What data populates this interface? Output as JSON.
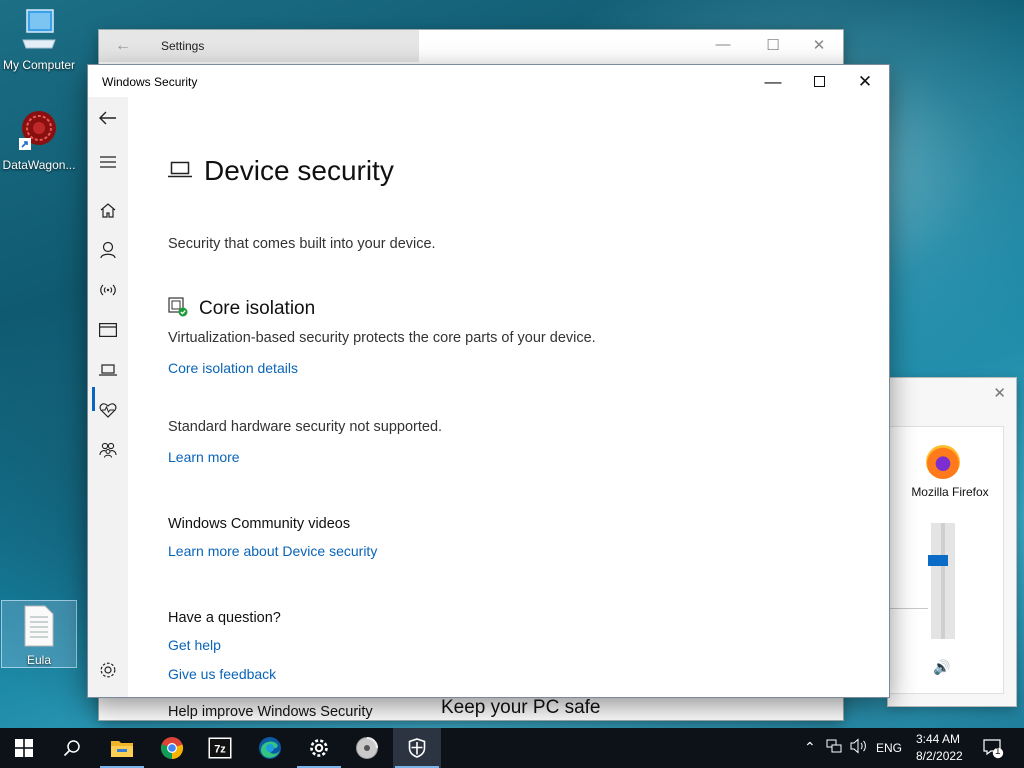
{
  "desktop": {
    "icons": [
      {
        "label": "My Computer"
      },
      {
        "label": "DataWagon..."
      },
      {
        "label": "Eula"
      }
    ]
  },
  "settings_window": {
    "title": "Settings",
    "banner_text": "Keep your PC safe"
  },
  "volume_mixer": {
    "app_name": "Mozilla Firefox",
    "volume_level_percent": 68
  },
  "security_window": {
    "title": "Windows Security",
    "page_title": "Device security",
    "page_subtitle": "Security that comes built into your device.",
    "core_isolation": {
      "title": "Core isolation",
      "description": "Virtualization-based security protects the core parts of your device.",
      "link": "Core isolation details"
    },
    "hardware": {
      "status": "Standard hardware security not supported.",
      "link": "Learn more"
    },
    "community": {
      "title": "Windows Community videos",
      "link": "Learn more about Device security"
    },
    "question": {
      "title": "Have a question?",
      "link": "Get help"
    },
    "improve": {
      "title": "Help improve Windows Security",
      "link": "Give us feedback"
    },
    "sidebar_icons": [
      "back-icon",
      "menu-icon",
      "home-icon",
      "person-icon",
      "wireless-icon",
      "browser-icon",
      "laptop-icon",
      "heart-icon",
      "family-icon",
      "gear-icon"
    ],
    "accent_color": "#0a64b8"
  },
  "taskbar": {
    "language": "ENG",
    "time": "3:44 AM",
    "date": "8/2/2022",
    "notification_count": "1",
    "apps": [
      "start-icon",
      "search-icon",
      "file-explorer-icon",
      "chrome-icon",
      "7zip-icon",
      "edge-icon",
      "settings-icon",
      "disc-icon",
      "windows-security-icon"
    ]
  }
}
